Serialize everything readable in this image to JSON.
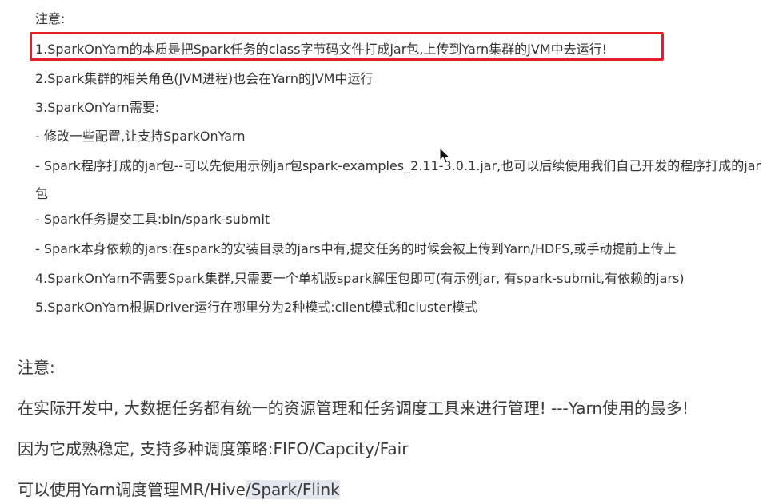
{
  "notes": {
    "heading": "注意:",
    "items": [
      "1.SparkOnYarn的本质是把Spark任务的class字节码文件打成jar包,上传到Yarn集群的JVM中去运行!",
      "2.Spark集群的相关角色(JVM进程)也会在Yarn的JVM中运行",
      "3.SparkOnYarn需要:",
      "- 修改一些配置,让支持SparkOnYarn",
      "- Spark程序打成的jar包--可以先使用示例jar包spark-examples_2.11-3.0.1.jar,也可以后续使用我们自己开发的程序打成的jar包",
      "- Spark任务提交工具:bin/spark-submit",
      "- Spark本身依赖的jars:在spark的安装目录的jars中有,提交任务的时候会被上传到Yarn/HDFS,或手动提前上传上",
      "4.SparkOnYarn不需要Spark集群,只需要一个单机版spark解压包即可(有示例jar, 有spark-submit,有依赖的jars)",
      "5.SparkOnYarn根据Driver运行在哪里分为2种模式:client模式和cluster模式"
    ],
    "highlight_color": "#e0202a"
  },
  "summary": {
    "heading": "注意:",
    "line1": "在实际开发中, 大数据任务都有统一的资源管理和任务调度工具来进行管理! ---Yarn使用的最多!",
    "line2": "因为它成熟稳定, 支持多种调度策略:FIFO/Capcity/Fair",
    "line3_prefix": "可以使用Yarn调度管理MR/Hive",
    "line3_selected": "/Spark/Flink",
    "selection_color": "#e3e7ee"
  },
  "cursor": {
    "icon": "mouse-pointer-icon"
  }
}
